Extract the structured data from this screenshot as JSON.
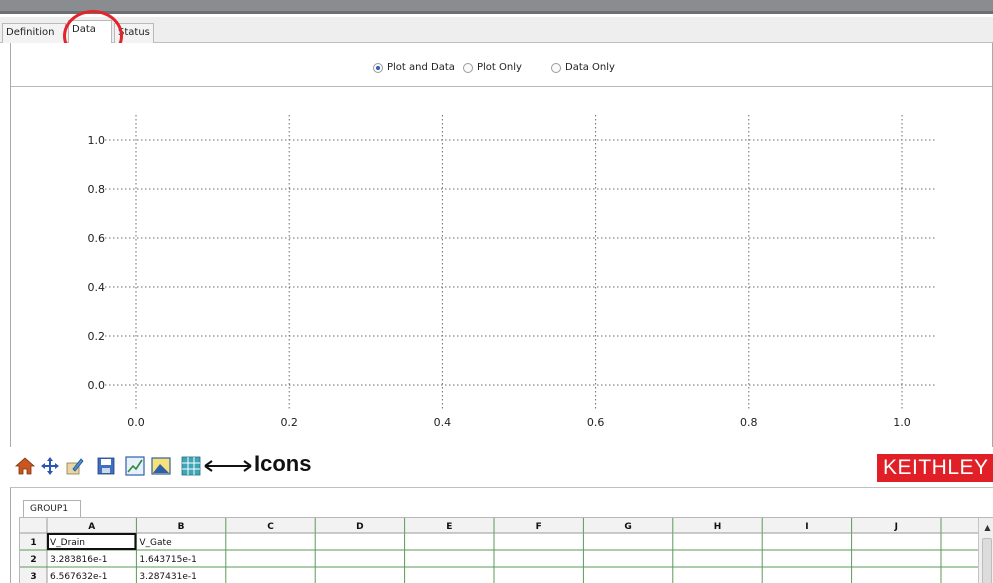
{
  "tabs": [
    {
      "label": "Definition",
      "active": false
    },
    {
      "label": "Data",
      "active": true
    },
    {
      "label": "Status",
      "active": false
    }
  ],
  "view_mode": {
    "options": [
      "Plot and Data",
      "Plot Only",
      "Data Only"
    ],
    "selected": "Plot and Data"
  },
  "toolbar": {
    "icons": [
      "home-icon",
      "move-icon",
      "edit-icon",
      "save-icon",
      "chart-icon",
      "image-icon",
      "table-icon"
    ],
    "annotation": "Icons"
  },
  "brand": {
    "logo_text": "KEITHLEY",
    "color": "#e01f26"
  },
  "highlight_color": "#e3242b",
  "chart_data": {
    "type": "line",
    "title": "",
    "xlabel": "",
    "ylabel": "",
    "xlim": [
      0.0,
      1.0
    ],
    "ylim": [
      0.0,
      1.0
    ],
    "x_ticks": [
      "0.0",
      "0.2",
      "0.4",
      "0.6",
      "0.8",
      "1.0"
    ],
    "y_ticks": [
      "0.0",
      "0.2",
      "0.4",
      "0.6",
      "0.8",
      "1.0"
    ],
    "grid": true,
    "series": []
  },
  "sheet": {
    "group_tab": "GROUP1",
    "columns": [
      "A",
      "B",
      "C",
      "D",
      "E",
      "F",
      "G",
      "H",
      "I",
      "J"
    ],
    "rows": [
      {
        "num": "1",
        "cells": [
          "V_Drain",
          "V_Gate"
        ]
      },
      {
        "num": "2",
        "cells": [
          "3.283816e-1",
          "1.643715e-1"
        ]
      },
      {
        "num": "3",
        "cells": [
          "6.567632e-1",
          "3.287431e-1"
        ]
      }
    ]
  }
}
